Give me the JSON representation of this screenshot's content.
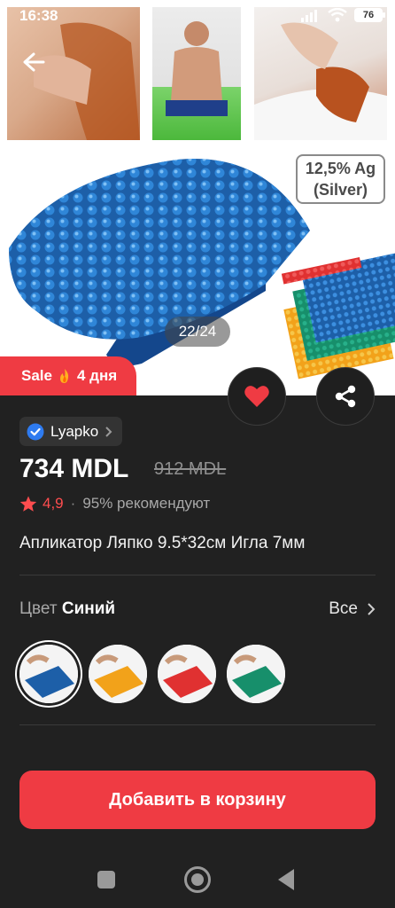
{
  "status_bar": {
    "time": "16:38",
    "battery": "76"
  },
  "gallery": {
    "counter": "22/24",
    "badge_line1": "12,5% Ag",
    "badge_line2": "(Silver)"
  },
  "sale": {
    "label": "Sale",
    "days": "4 дня"
  },
  "product": {
    "brand": "Lyapko",
    "price": "734 MDL",
    "old_price": "912 MDL",
    "rating": "4,9",
    "recommend": "95% рекомендуют",
    "title": "Апликатор Ляпко 9.5*32см Игла 7мм"
  },
  "color": {
    "label": "Цвет",
    "selected": "Синий",
    "see_all": "Все",
    "swatches": [
      {
        "name": "blue",
        "color": "#1d5fa8"
      },
      {
        "name": "orange",
        "color": "#f2a21a"
      },
      {
        "name": "red",
        "color": "#e03131"
      },
      {
        "name": "green",
        "color": "#178f6b"
      }
    ]
  },
  "cart_button": "Добавить в корзину",
  "colors": {
    "accent": "#ef3b43",
    "background": "#212121",
    "rating": "#ff4d4f"
  },
  "icons": [
    "back-arrow-icon",
    "heart-icon",
    "share-icon",
    "verified-icon",
    "chevron-right-icon",
    "star-icon",
    "fire-icon"
  ]
}
